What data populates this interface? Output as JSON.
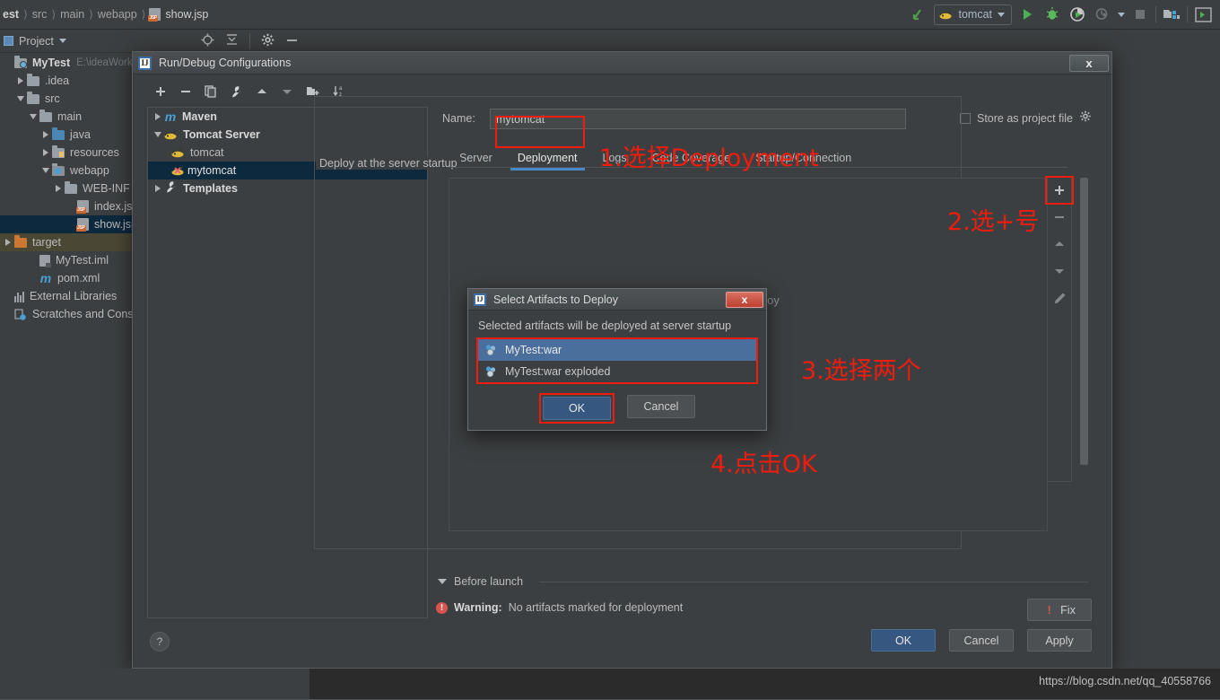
{
  "ide": {
    "breadcrumb": [
      {
        "label": "est",
        "icon": "none"
      },
      {
        "label": "src",
        "icon": "none"
      },
      {
        "label": "main",
        "icon": "none"
      },
      {
        "label": "webapp",
        "icon": "none"
      },
      {
        "label": "show.jsp",
        "icon": "jsp-file-icon"
      }
    ],
    "toolbar": {
      "run_config_name": "tomcat",
      "icons": [
        "build-icon",
        "run-icon",
        "debug-icon",
        "run-coverage-icon",
        "profiler-icon",
        "stop-icon",
        "project-structure-icon",
        "open-preview-icon"
      ]
    },
    "project_panel": {
      "title": "Project",
      "icons": [
        "locate-icon",
        "collapse-all-icon",
        "gear-icon",
        "minimize-icon"
      ]
    },
    "tree": [
      {
        "label": "MyTest",
        "sub": "E:\\ideaWork",
        "icon": "module-folder-icon",
        "indent": 0,
        "twisty": "none",
        "bold": true,
        "state": "normal"
      },
      {
        "label": ".idea",
        "sub": "",
        "icon": "folder-icon",
        "indent": 1,
        "twisty": "right",
        "bold": false,
        "state": "normal"
      },
      {
        "label": "src",
        "sub": "",
        "icon": "folder-icon",
        "indent": 1,
        "twisty": "down",
        "bold": false,
        "state": "normal"
      },
      {
        "label": "main",
        "sub": "",
        "icon": "folder-icon",
        "indent": 2,
        "twisty": "down",
        "bold": false,
        "state": "normal"
      },
      {
        "label": "java",
        "sub": "",
        "icon": "source-folder-icon",
        "indent": 3,
        "twisty": "right",
        "bold": false,
        "state": "normal"
      },
      {
        "label": "resources",
        "sub": "",
        "icon": "resources-folder-icon",
        "indent": 3,
        "twisty": "right",
        "bold": false,
        "state": "normal"
      },
      {
        "label": "webapp",
        "sub": "",
        "icon": "web-folder-icon",
        "indent": 3,
        "twisty": "down",
        "bold": false,
        "state": "normal"
      },
      {
        "label": "WEB-INF",
        "sub": "",
        "icon": "folder-icon",
        "indent": 4,
        "twisty": "right",
        "bold": false,
        "state": "normal"
      },
      {
        "label": "index.jsp",
        "sub": "",
        "icon": "jsp-file-icon",
        "indent": 5,
        "twisty": "none",
        "bold": false,
        "state": "normal"
      },
      {
        "label": "show.jsp",
        "sub": "",
        "icon": "jsp-file-icon",
        "indent": 5,
        "twisty": "none",
        "bold": false,
        "state": "selected"
      },
      {
        "label": "target",
        "sub": "",
        "icon": "excluded-folder-icon",
        "indent": 1,
        "twisty": "right",
        "bold": false,
        "state": "highlight"
      },
      {
        "label": "MyTest.iml",
        "sub": "",
        "icon": "iml-file-icon",
        "indent": 2,
        "twisty": "none",
        "bold": false,
        "state": "normal"
      },
      {
        "label": "pom.xml",
        "sub": "",
        "icon": "maven-file-icon",
        "indent": 2,
        "twisty": "none",
        "bold": false,
        "state": "normal"
      },
      {
        "label": "External Libraries",
        "sub": "",
        "icon": "libraries-icon",
        "indent": 0,
        "twisty": "none",
        "bold": false,
        "state": "normal"
      },
      {
        "label": "Scratches and Conso",
        "sub": "",
        "icon": "scratches-icon",
        "indent": 0,
        "twisty": "none",
        "bold": false,
        "state": "normal"
      }
    ],
    "watermark": "https://blog.csdn.net/qq_40558766"
  },
  "dialog": {
    "title": "Run/Debug Configurations",
    "close_label": "x",
    "toolbar_icons": [
      "add-icon",
      "remove-icon",
      "copy-icon",
      "edit-templates-icon",
      "move-up-icon",
      "move-down-icon",
      "create-folder-icon",
      "sort-configurations-icon"
    ],
    "config_tree": [
      {
        "label": "Maven",
        "icon": "maven-icon",
        "indent": 0,
        "twisty": "right",
        "bold": true,
        "selected": false
      },
      {
        "label": "Tomcat Server",
        "icon": "tomcat-icon",
        "indent": 0,
        "twisty": "down",
        "bold": true,
        "selected": false
      },
      {
        "label": "tomcat",
        "icon": "tomcat-icon",
        "indent": 1,
        "twisty": "none",
        "bold": false,
        "selected": false
      },
      {
        "label": "mytomcat",
        "icon": "tomcat-error-icon",
        "indent": 1,
        "twisty": "none",
        "bold": false,
        "selected": true
      },
      {
        "label": "Templates",
        "icon": "wrench-icon",
        "indent": 0,
        "twisty": "right",
        "bold": true,
        "selected": false
      }
    ],
    "name_label": "Name:",
    "name_value": "mytomcat",
    "store_as_project_file": "Store as project file",
    "tabs": [
      {
        "label": "Server",
        "active": false
      },
      {
        "label": "Deployment",
        "active": true
      },
      {
        "label": "Logs",
        "active": false
      },
      {
        "label": "Code Coverage",
        "active": false
      },
      {
        "label": "Startup/Connection",
        "active": false
      }
    ],
    "deploy_section_label": "Deploy at the server startup",
    "deploy_ghost_text": "ploy",
    "side_tool_icons": [
      "add-artifact-icon",
      "remove-artifact-icon",
      "move-up-icon",
      "move-down-icon",
      "edit-artifact-icon"
    ],
    "before_launch_label": "Before launch",
    "warning_prefix": "Warning:",
    "warning_text": "No artifacts marked for deployment",
    "fix_label": "Fix",
    "help_label": "?",
    "buttons": {
      "ok": "OK",
      "cancel": "Cancel",
      "apply": "Apply"
    }
  },
  "inner_dialog": {
    "title": "Select Artifacts to Deploy",
    "close_label": "x",
    "hint": "Selected artifacts will be deployed at server startup",
    "artifacts": [
      {
        "label": "MyTest:war",
        "selected": true
      },
      {
        "label": "MyTest:war exploded",
        "selected": false
      }
    ],
    "ok_label": "OK",
    "cancel_label": "Cancel"
  },
  "annotations": [
    {
      "id": "step1",
      "text": "1.选择Deployment"
    },
    {
      "id": "step2",
      "text": "2.选+号"
    },
    {
      "id": "step3",
      "text": "3.选择两个"
    },
    {
      "id": "step4",
      "text": "4.点击OK"
    }
  ],
  "colors": {
    "accent_blue": "#4a88c7",
    "annotation_red": "#f01c0d",
    "selection_blue": "#0d293e",
    "panel_bg": "#3c3f41"
  }
}
